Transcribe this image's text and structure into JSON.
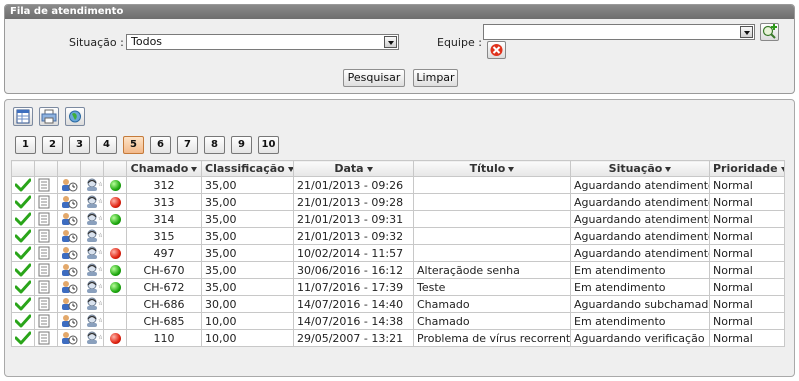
{
  "filter": {
    "title": "Fila de atendimento",
    "situacao_label": "Situação :",
    "situacao_value": "Todos",
    "equipe_label": "Equipe :",
    "equipe_value": "",
    "search_label": "Pesquisar",
    "clear_label": "Limpar"
  },
  "pagination": [
    "1",
    "2",
    "3",
    "4",
    "5",
    "6",
    "7",
    "8",
    "9",
    "10"
  ],
  "active_page": "5",
  "columns": {
    "chamado": "Chamado",
    "classificacao": "Classificação",
    "data": "Data",
    "titulo": "Título",
    "situacao": "Situação",
    "prioridade": "Prioridade"
  },
  "rows": [
    {
      "status": "green",
      "chamado": "312",
      "classificacao": "35,00",
      "data": "21/01/2013 - 09:26",
      "titulo": "",
      "situacao": "Aguardando atendimento",
      "prioridade": "Normal"
    },
    {
      "status": "red",
      "chamado": "313",
      "classificacao": "35,00",
      "data": "21/01/2013 - 09:28",
      "titulo": "",
      "situacao": "Aguardando atendimento",
      "prioridade": "Normal"
    },
    {
      "status": "green",
      "chamado": "314",
      "classificacao": "35,00",
      "data": "21/01/2013 - 09:31",
      "titulo": "",
      "situacao": "Aguardando atendimento",
      "prioridade": "Normal"
    },
    {
      "status": "",
      "chamado": "315",
      "classificacao": "35,00",
      "data": "21/01/2013 - 09:32",
      "titulo": "",
      "situacao": "Aguardando atendimento",
      "prioridade": "Normal"
    },
    {
      "status": "red",
      "chamado": "497",
      "classificacao": "35,00",
      "data": "10/02/2014 - 11:57",
      "titulo": "",
      "situacao": "Aguardando atendimento",
      "prioridade": "Normal"
    },
    {
      "status": "green",
      "chamado": "CH-670",
      "classificacao": "35,00",
      "data": "30/06/2016 - 16:12",
      "titulo": "Alteraçãode senha",
      "situacao": "Em atendimento",
      "prioridade": "Normal"
    },
    {
      "status": "green",
      "chamado": "CH-672",
      "classificacao": "35,00",
      "data": "11/07/2016 - 17:39",
      "titulo": "Teste",
      "situacao": "Em atendimento",
      "prioridade": "Normal"
    },
    {
      "status": "",
      "chamado": "CH-686",
      "classificacao": "30,00",
      "data": "14/07/2016 - 14:40",
      "titulo": "Chamado",
      "situacao": "Aguardando subchamado",
      "prioridade": "Normal"
    },
    {
      "status": "",
      "chamado": "CH-685",
      "classificacao": "10,00",
      "data": "14/07/2016 - 14:38",
      "titulo": "Chamado",
      "situacao": "Em atendimento",
      "prioridade": "Normal"
    },
    {
      "status": "red",
      "chamado": "110",
      "classificacao": "10,00",
      "data": "29/05/2007 - 13:21",
      "titulo": "Problema de vírus recorrente",
      "situacao": "Aguardando verificação",
      "prioridade": "Normal"
    }
  ],
  "icons": {
    "select_all": "check-icon",
    "notes": "document-icon",
    "people": "users-clock-icon",
    "attendant": "agent-icon",
    "toolbar": [
      "table-view-icon",
      "print-icon",
      "globe-icon"
    ],
    "add_team": "add-team-icon",
    "remove_team": "remove-icon"
  }
}
